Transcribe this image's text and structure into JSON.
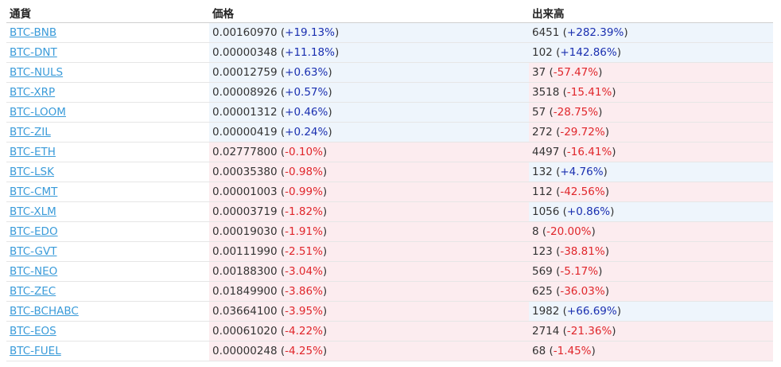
{
  "columns": [
    "通貨",
    "価格",
    "出来高"
  ],
  "colors": {
    "link": "#3a9bd9",
    "up_text": "#1a2fb0",
    "down_text": "#e0262b",
    "up_bg": "#eef5fc",
    "down_bg": "#fcecef"
  },
  "rows": [
    {
      "symbol": "BTC-BNB",
      "price": "0.00160970",
      "price_change": "+19.13%",
      "volume": "6451",
      "volume_change": "+282.39%"
    },
    {
      "symbol": "BTC-DNT",
      "price": "0.00000348",
      "price_change": "+11.18%",
      "volume": "102",
      "volume_change": "+142.86%"
    },
    {
      "symbol": "BTC-NULS",
      "price": "0.00012759",
      "price_change": "+0.63%",
      "volume": "37",
      "volume_change": "-57.47%"
    },
    {
      "symbol": "BTC-XRP",
      "price": "0.00008926",
      "price_change": "+0.57%",
      "volume": "3518",
      "volume_change": "-15.41%"
    },
    {
      "symbol": "BTC-LOOM",
      "price": "0.00001312",
      "price_change": "+0.46%",
      "volume": "57",
      "volume_change": "-28.75%"
    },
    {
      "symbol": "BTC-ZIL",
      "price": "0.00000419",
      "price_change": "+0.24%",
      "volume": "272",
      "volume_change": "-29.72%"
    },
    {
      "symbol": "BTC-ETH",
      "price": "0.02777800",
      "price_change": "-0.10%",
      "volume": "4497",
      "volume_change": "-16.41%"
    },
    {
      "symbol": "BTC-LSK",
      "price": "0.00035380",
      "price_change": "-0.98%",
      "volume": "132",
      "volume_change": "+4.76%"
    },
    {
      "symbol": "BTC-CMT",
      "price": "0.00001003",
      "price_change": "-0.99%",
      "volume": "112",
      "volume_change": "-42.56%"
    },
    {
      "symbol": "BTC-XLM",
      "price": "0.00003719",
      "price_change": "-1.82%",
      "volume": "1056",
      "volume_change": "+0.86%"
    },
    {
      "symbol": "BTC-EDO",
      "price": "0.00019030",
      "price_change": "-1.91%",
      "volume": "8",
      "volume_change": "-20.00%"
    },
    {
      "symbol": "BTC-GVT",
      "price": "0.00111990",
      "price_change": "-2.51%",
      "volume": "123",
      "volume_change": "-38.81%"
    },
    {
      "symbol": "BTC-NEO",
      "price": "0.00188300",
      "price_change": "-3.04%",
      "volume": "569",
      "volume_change": "-5.17%"
    },
    {
      "symbol": "BTC-ZEC",
      "price": "0.01849900",
      "price_change": "-3.86%",
      "volume": "625",
      "volume_change": "-36.03%"
    },
    {
      "symbol": "BTC-BCHABC",
      "price": "0.03664100",
      "price_change": "-3.95%",
      "volume": "1982",
      "volume_change": "+66.69%"
    },
    {
      "symbol": "BTC-EOS",
      "price": "0.00061020",
      "price_change": "-4.22%",
      "volume": "2714",
      "volume_change": "-21.36%"
    },
    {
      "symbol": "BTC-FUEL",
      "price": "0.00000248",
      "price_change": "-4.25%",
      "volume": "68",
      "volume_change": "-1.45%"
    }
  ]
}
